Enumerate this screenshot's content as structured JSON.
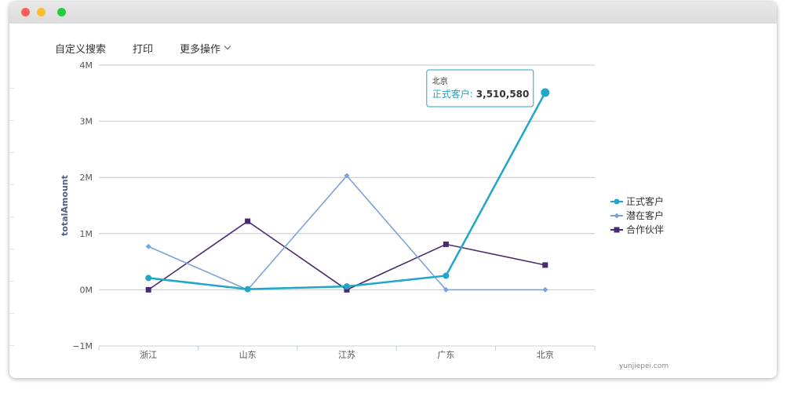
{
  "window": {
    "buttons": {
      "close": "red",
      "minimize": "yellow",
      "zoom": "green"
    }
  },
  "toolbar": {
    "custom_search": "自定义搜索",
    "print": "打印",
    "more_actions": "更多操作",
    "more_icon": "chevron-down-icon"
  },
  "credit": "yunjiepei.com",
  "chart_data": {
    "type": "line",
    "categories": [
      "浙江",
      "山东",
      "江苏",
      "广东",
      "北京"
    ],
    "ylabel": "totalAmount",
    "xlabel": "",
    "ylim": [
      -1000000,
      4000000
    ],
    "yticks": [
      -1000000,
      0,
      1000000,
      2000000,
      3000000,
      4000000
    ],
    "ytick_labels": [
      "−1M",
      "0M",
      "1M",
      "2M",
      "3M",
      "4M"
    ],
    "grid": true,
    "legend": "right",
    "series": [
      {
        "name": "正式客户",
        "color": "#1fa6c9",
        "marker": "circle",
        "values": [
          210000,
          10000,
          60000,
          250000,
          3510580
        ]
      },
      {
        "name": "潜在客户",
        "color": "#7aa3d9",
        "marker": "diamond",
        "values": [
          770000,
          0,
          2030000,
          0,
          0
        ]
      },
      {
        "name": "合作伙伴",
        "color": "#4a2a6e",
        "marker": "square",
        "values": [
          0,
          1220000,
          0,
          810000,
          440000
        ]
      }
    ],
    "tooltip": {
      "category": "北京",
      "series": "正式客户",
      "label": "正式客户:",
      "value": "3,510,580"
    }
  }
}
